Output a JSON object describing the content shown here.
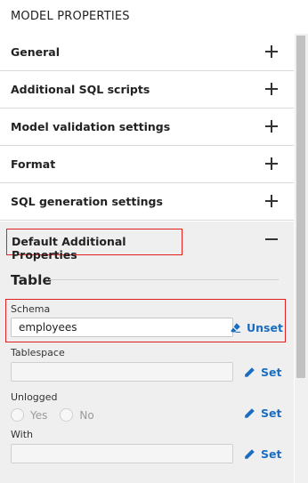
{
  "header": {
    "title": "MODEL PROPERTIES"
  },
  "accordion": {
    "general": "General",
    "sql_scripts": "Additional SQL scripts",
    "validation": "Model validation settings",
    "format": "Format",
    "sql_generation": "SQL generation settings",
    "default_props": "Default Additional Properties"
  },
  "table_section": {
    "title": "Table",
    "schema": {
      "label": "Schema",
      "value": "employees",
      "action": "Unset"
    },
    "tablespace": {
      "label": "Tablespace",
      "value": "",
      "action": "Set"
    },
    "unlogged": {
      "label": "Unlogged",
      "yes": "Yes",
      "no": "No",
      "action": "Set"
    },
    "with": {
      "label": "With",
      "value": "",
      "action": "Set"
    }
  },
  "colors": {
    "accent": "#1b6dc1",
    "highlight": "#e02020"
  },
  "icons": [
    "plus-icon",
    "minus-icon",
    "eraser-icon",
    "pencil-icon"
  ]
}
